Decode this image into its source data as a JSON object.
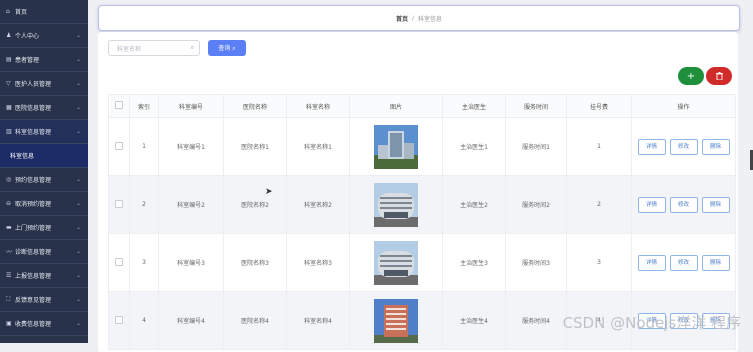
{
  "sidebar": {
    "items": [
      {
        "icon": "home-icon",
        "glyph": "⌂",
        "label": "首页",
        "chevron": false,
        "state": "normal"
      },
      {
        "icon": "user-icon",
        "glyph": "♟",
        "label": "个人中心",
        "chevron": true,
        "state": "normal"
      },
      {
        "icon": "patient-icon",
        "glyph": "▤",
        "label": "患者管理",
        "chevron": true,
        "state": "normal"
      },
      {
        "icon": "staff-icon",
        "glyph": "▽",
        "label": "医护人员管理",
        "chevron": true,
        "state": "normal"
      },
      {
        "icon": "hospital-icon",
        "glyph": "▦",
        "label": "医院信息管理",
        "chevron": true,
        "state": "normal"
      },
      {
        "icon": "department-icon",
        "glyph": "▥",
        "label": "科室信息管理",
        "chevron": true,
        "state": "active"
      },
      {
        "icon": "",
        "glyph": "",
        "label": "科室信息",
        "chevron": false,
        "state": "sub"
      },
      {
        "icon": "appointment-icon",
        "glyph": "◎",
        "label": "预约信息管理",
        "chevron": true,
        "state": "normal"
      },
      {
        "icon": "cancel-icon",
        "glyph": "⊖",
        "label": "取消预约管理",
        "chevron": true,
        "state": "normal"
      },
      {
        "icon": "visit-icon",
        "glyph": "▬",
        "label": "上门预约管理",
        "chevron": true,
        "state": "normal"
      },
      {
        "icon": "diagnosis-icon",
        "glyph": "〰",
        "label": "诊断信息管理",
        "chevron": true,
        "state": "normal"
      },
      {
        "icon": "report-icon",
        "glyph": "☰",
        "label": "上报信息管理",
        "chevron": true,
        "state": "normal"
      },
      {
        "icon": "feedback-icon",
        "glyph": "⛶",
        "label": "反馈意见管理",
        "chevron": true,
        "state": "normal"
      },
      {
        "icon": "fee-icon",
        "glyph": "▣",
        "label": "收费信息管理",
        "chevron": true,
        "state": "normal"
      }
    ]
  },
  "breadcrumb": {
    "home": "首页",
    "separator": "/",
    "current": "科室信息"
  },
  "toolbar": {
    "search_placeholder": "科室名称",
    "search_icon": "search-icon",
    "search_button": "查询 ⌕",
    "add_button": "+",
    "delete_button": "🗑"
  },
  "table": {
    "headers": [
      "",
      "索引",
      "科室编号",
      "医院名称",
      "科室名称",
      "图片",
      "主治医生",
      "服务时间",
      "挂号费",
      "操作"
    ],
    "rows": [
      {
        "index": "1",
        "code": "科室编号1",
        "hospital": "医院名称1",
        "dept": "科室名称1",
        "image": "building-photo-tall",
        "doctor": "主治医生1",
        "time": "服务时间1",
        "fee": "1"
      },
      {
        "index": "2",
        "code": "科室编号2",
        "hospital": "医院名称2",
        "dept": "科室名称2",
        "image": "building-photo-round",
        "doctor": "主治医生2",
        "time": "服务时间2",
        "fee": "2"
      },
      {
        "index": "3",
        "code": "科室编号3",
        "hospital": "医院名称3",
        "dept": "科室名称3",
        "image": "building-photo-round",
        "doctor": "主治医生3",
        "time": "服务时间3",
        "fee": "3"
      },
      {
        "index": "4",
        "code": "科室编号4",
        "hospital": "医院名称4",
        "dept": "科室名称4",
        "image": "building-photo-red",
        "doctor": "主治医生4",
        "time": "服务时间4",
        "fee": "4"
      }
    ],
    "actions": {
      "detail": "详情",
      "edit": "修改",
      "delete": "删除"
    }
  },
  "watermark": "CSDN @Nodejs洋洋 程序",
  "colors": {
    "sidebar": "#28324a",
    "sub_active": "#1c2a66",
    "primary": "#5b7ff5",
    "add": "#1f8f3c",
    "delete": "#d12a2a"
  }
}
